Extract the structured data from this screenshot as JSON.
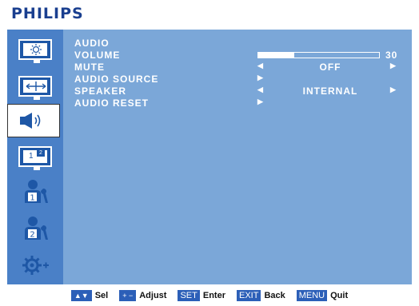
{
  "brand": "PHILIPS",
  "sidebar": {
    "items": [
      {
        "icon": "picture-icon"
      },
      {
        "icon": "screen-icon"
      },
      {
        "icon": "audio-icon",
        "selected": true
      },
      {
        "icon": "pip-icon",
        "label": "12"
      },
      {
        "icon": "config1-icon",
        "label": "1"
      },
      {
        "icon": "config2-icon",
        "label": "2"
      },
      {
        "icon": "advanced-option-icon"
      }
    ]
  },
  "menu": {
    "title": "AUDIO",
    "volume_label": "VOLUME",
    "volume_value": "30",
    "volume_level": 0.3,
    "mute_label": "MUTE",
    "mute_value": "OFF",
    "audio_source_label": "AUDIO SOURCE",
    "speaker_label": "SPEAKER",
    "speaker_value": "INTERNAL",
    "audio_reset_label": "AUDIO RESET"
  },
  "footer": {
    "sel_key": "▲▼",
    "sel_label": "Sel",
    "adjust_key": "+ −",
    "adjust_label": "Adjust",
    "enter_key": "SET",
    "enter_label": "Enter",
    "back_key": "EXIT",
    "back_label": "Back",
    "quit_key": "MENU",
    "quit_label": "Quit"
  },
  "colors": {
    "brand": "#1a3f8f",
    "osd_bg": "#7ba7d8",
    "sidebar_bg": "#4a80c7",
    "key_bg": "#2c5fb8"
  }
}
